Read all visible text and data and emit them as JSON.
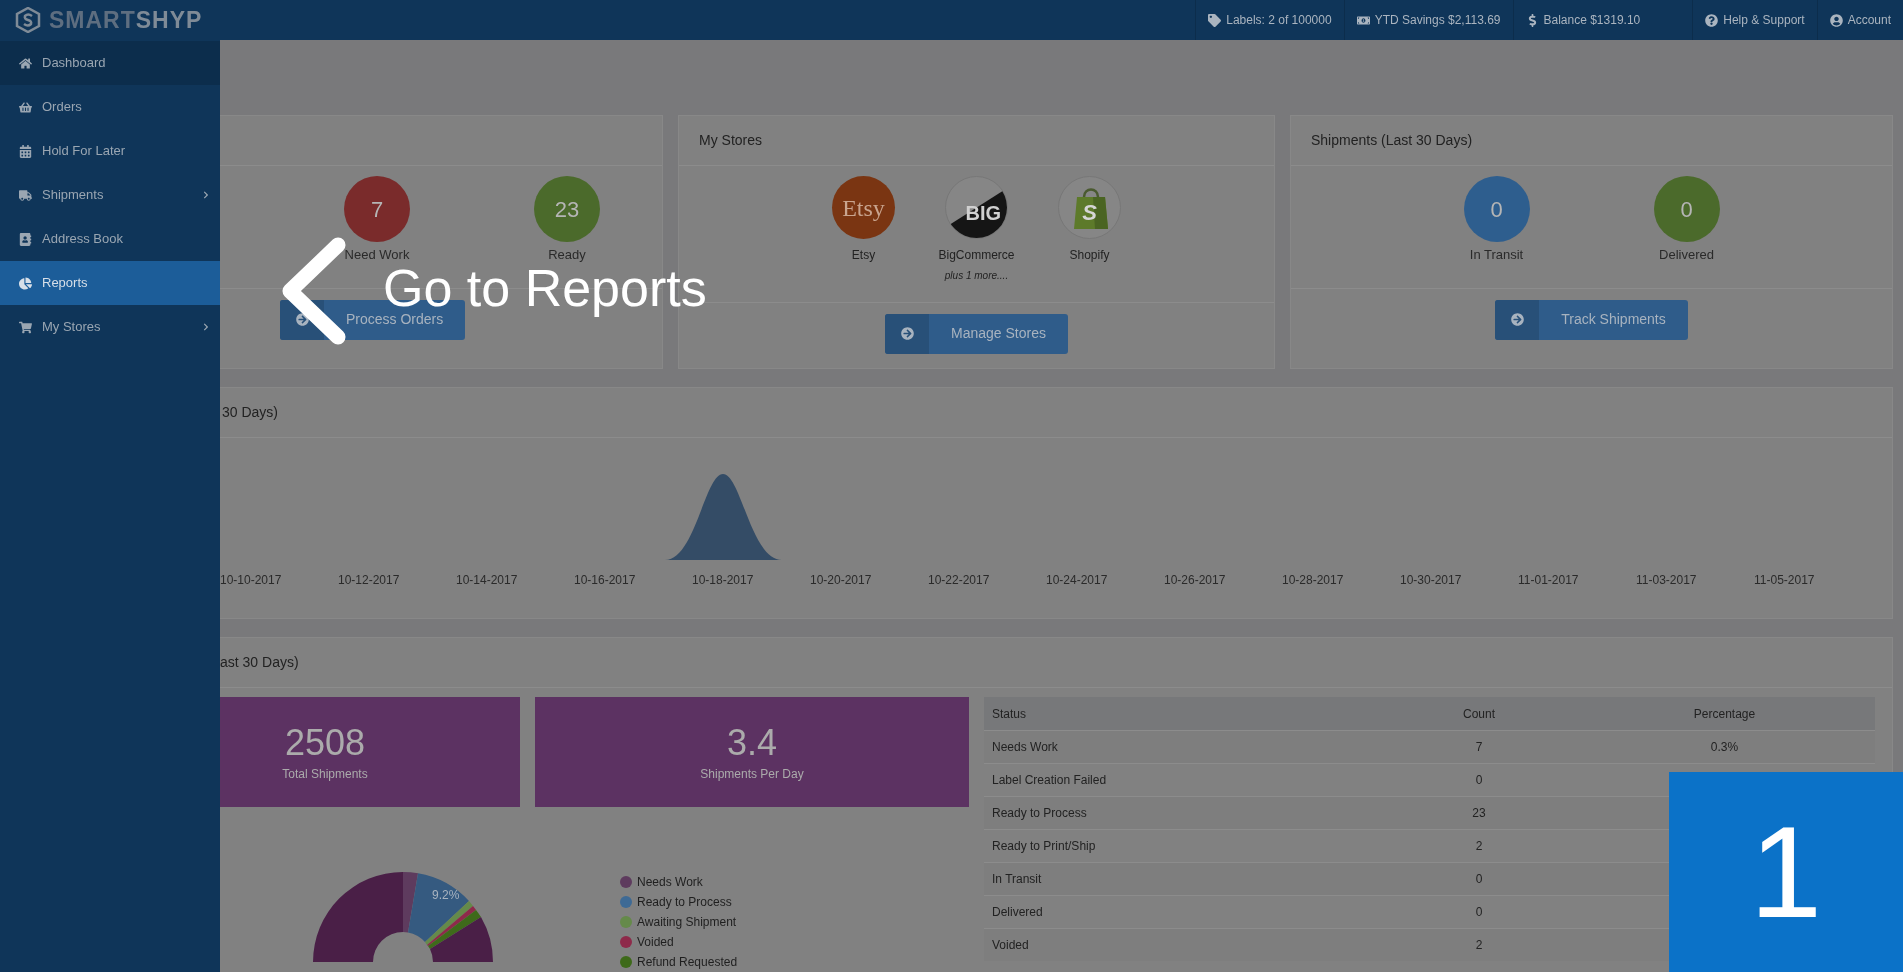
{
  "topbar": {
    "logo_parts": [
      "SMART",
      "SHYP"
    ],
    "stats": [
      {
        "text": "Labels: 2 of 100000"
      },
      {
        "text": "YTD Savings $2,113.69"
      },
      {
        "text": "Balance $1319.10"
      }
    ],
    "links": [
      {
        "text": "Help & Support"
      },
      {
        "text": "Account"
      }
    ]
  },
  "sidebar": {
    "items": [
      {
        "label": "Dashboard",
        "selected": false,
        "submenu": false
      },
      {
        "label": "Orders",
        "selected": false,
        "submenu": false
      },
      {
        "label": "Hold For Later",
        "selected": false,
        "submenu": false
      },
      {
        "label": "Shipments",
        "selected": false,
        "submenu": true
      },
      {
        "label": "Address Book",
        "selected": false,
        "submenu": false
      },
      {
        "label": "Reports",
        "selected": true,
        "submenu": false
      },
      {
        "label": "My Stores",
        "selected": false,
        "submenu": true
      }
    ]
  },
  "orders_card": {
    "stats": [
      {
        "value": "7",
        "label": "Need Work",
        "color": "#7a2b2b"
      },
      {
        "value": "23",
        "label": "Ready",
        "color": "#4b6a2b"
      }
    ],
    "button": "Process Orders"
  },
  "stores_card": {
    "title": "My Stores",
    "stores": [
      {
        "kind": "etsy",
        "logo_text": "Etsy",
        "name": "Etsy"
      },
      {
        "kind": "bigcommerce",
        "logo_text": "BIG",
        "name": "BigCommerce"
      },
      {
        "kind": "shopify",
        "logo_text": "S",
        "name": "Shopify"
      }
    ],
    "note": "plus 1 more....",
    "button": "Manage Stores"
  },
  "shipments_card": {
    "title": "Shipments (Last 30 Days)",
    "stats": [
      {
        "value": "0",
        "label": "In Transit",
        "color": "#2e5e8e"
      },
      {
        "value": "0",
        "label": "Delivered",
        "color": "#4b6a2b"
      }
    ],
    "button": "Track Shipments"
  },
  "chart_panel": {
    "title": "30 Days)",
    "x_labels": [
      "10-10-2017",
      "10-12-2017",
      "10-14-2017",
      "10-16-2017",
      "10-18-2017",
      "10-20-2017",
      "10-22-2017",
      "10-24-2017",
      "10-26-2017",
      "10-28-2017",
      "10-30-2017",
      "11-01-2017",
      "11-03-2017",
      "11-05-2017"
    ]
  },
  "summary_panel": {
    "title": "ast 30 Days)",
    "tiles": [
      {
        "value": "2508",
        "label": "Total Shipments"
      },
      {
        "value": "3.4",
        "label": "Shipments Per Day"
      }
    ],
    "donut_label": "9.2%",
    "legend": [
      {
        "label": "Needs Work",
        "color": "#5e3b5e"
      },
      {
        "label": "Ready to Process",
        "color": "#3e6a95"
      },
      {
        "label": "Awaiting Shipment",
        "color": "#658a4a"
      },
      {
        "label": "Voided",
        "color": "#8e2a4a"
      },
      {
        "label": "Refund Requested",
        "color": "#3e6a1a"
      }
    ],
    "table": {
      "columns": [
        "Status",
        "Count",
        "Percentage"
      ],
      "rows": [
        {
          "status": "Needs Work",
          "count": "7",
          "percentage": "0.3%"
        },
        {
          "status": "Label Creation Failed",
          "count": "0"
        },
        {
          "status": "Ready to Process",
          "count": "23"
        },
        {
          "status": "Ready to Print/Ship",
          "count": "2"
        },
        {
          "status": "In Transit",
          "count": "0"
        },
        {
          "status": "Delivered",
          "count": "0"
        },
        {
          "status": "Voided",
          "count": "2"
        }
      ]
    }
  },
  "tour": {
    "callout": "Go to Reports",
    "step": "1"
  }
}
